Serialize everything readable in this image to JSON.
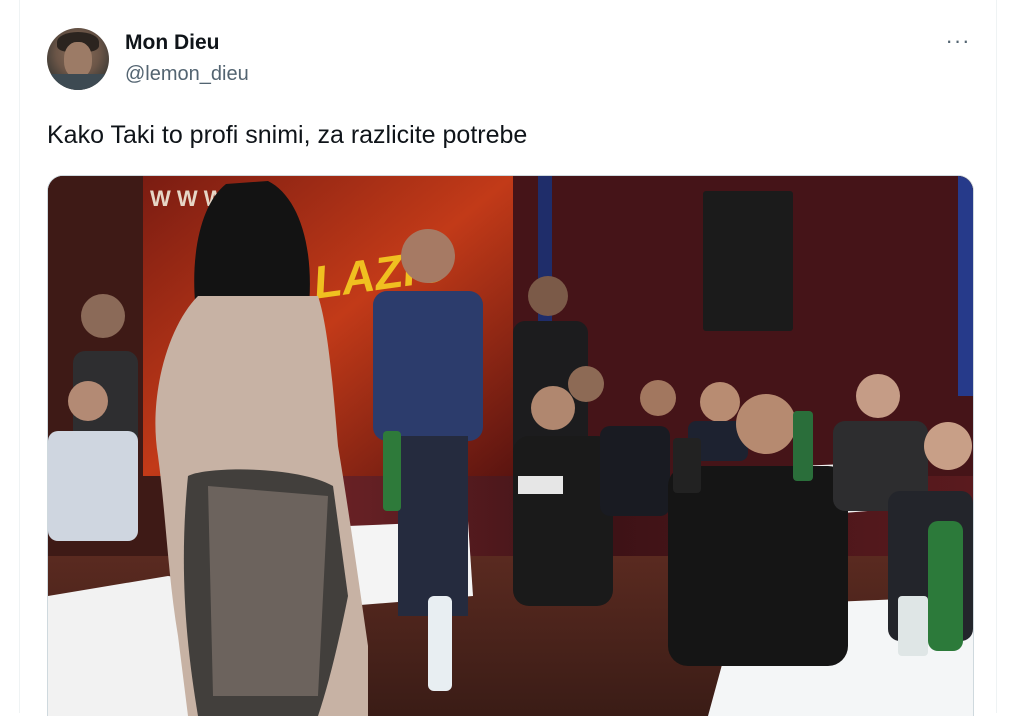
{
  "tweet": {
    "author_name": "Mon Dieu",
    "author_handle": "@lemon_dieu",
    "more_label": "···",
    "text": "Kako Taki to profi snimi, za razlicite potrebe"
  },
  "media": {
    "banner_text": "LAZIĆ",
    "side_letters": "W W W"
  },
  "colors": {
    "text_primary": "#0f1419",
    "text_secondary": "#536471",
    "border": "#cfd9de"
  }
}
